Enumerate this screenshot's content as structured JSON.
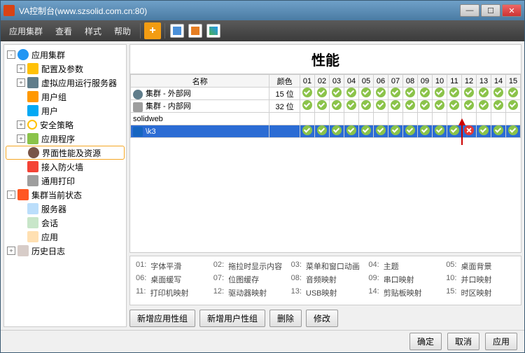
{
  "window": {
    "title": "VA控制台(www.szsolid.com.cn:80)"
  },
  "menu": {
    "appcluster": "应用集群",
    "view": "查看",
    "style": "样式",
    "help": "帮助"
  },
  "tree": {
    "root": "应用集群",
    "items": [
      {
        "label": "配置及参数",
        "icon": "ic-cfg",
        "exp": "+"
      },
      {
        "label": "虚拟应用运行服务器",
        "icon": "ic-srv",
        "exp": "+"
      },
      {
        "label": "用户组",
        "icon": "ic-grp",
        "exp": ""
      },
      {
        "label": "用户",
        "icon": "ic-usr",
        "exp": ""
      },
      {
        "label": "安全策略",
        "icon": "ic-sec",
        "exp": "+"
      },
      {
        "label": "应用程序",
        "icon": "ic-prog",
        "exp": "+"
      },
      {
        "label": "界面性能及资源",
        "icon": "ic-perf",
        "exp": "",
        "selected": true
      },
      {
        "label": "接入防火墙",
        "icon": "ic-fw",
        "exp": ""
      },
      {
        "label": "通用打印",
        "icon": "ic-prn",
        "exp": ""
      }
    ],
    "status": {
      "label": "集群当前状态",
      "children": [
        {
          "label": "服务器",
          "icon": "ic-server"
        },
        {
          "label": "会话",
          "icon": "ic-sess"
        },
        {
          "label": "应用",
          "icon": "ic-app2"
        }
      ]
    },
    "history": "历史日志"
  },
  "panel": {
    "title": "性能",
    "headers": {
      "name": "名称",
      "color": "颜色"
    },
    "cols": [
      "01",
      "02",
      "03",
      "04",
      "05",
      "06",
      "07",
      "08",
      "09",
      "10",
      "11",
      "12",
      "13",
      "14",
      "15"
    ],
    "rows": [
      {
        "name": "集群 - 外部网",
        "icon": "ri-globe",
        "color": "15 位",
        "fail": []
      },
      {
        "name": "集群 - 内部网",
        "icon": "ri-home",
        "color": "32 位",
        "fail": []
      },
      {
        "name": "solidweb",
        "icon": "",
        "color": "",
        "fail": [],
        "empty": true
      },
      {
        "name": "\\k3",
        "icon": "ri-k",
        "color": "",
        "fail": [
          12
        ],
        "selected": true
      }
    ]
  },
  "legend": [
    [
      {
        "n": "01:",
        "t": "字体平滑"
      },
      {
        "n": "02:",
        "t": "拖拉时显示内容"
      },
      {
        "n": "03:",
        "t": "菜单和窗口动画"
      },
      {
        "n": "04:",
        "t": "主题"
      },
      {
        "n": "05:",
        "t": "桌面背景"
      }
    ],
    [
      {
        "n": "06:",
        "t": "桌面缓写"
      },
      {
        "n": "07:",
        "t": "位图缓存"
      },
      {
        "n": "08:",
        "t": "音频映射"
      },
      {
        "n": "09:",
        "t": "串口映射"
      },
      {
        "n": "10:",
        "t": "并口映射"
      }
    ],
    [
      {
        "n": "11:",
        "t": "打印机映射"
      },
      {
        "n": "12:",
        "t": "驱动器映射"
      },
      {
        "n": "13:",
        "t": "USB映射"
      },
      {
        "n": "14:",
        "t": "剪贴板映射"
      },
      {
        "n": "15:",
        "t": "时区映射"
      }
    ]
  ],
  "actions": {
    "addAppGrp": "新增应用性组",
    "addUsrGrp": "新增用户性组",
    "delete": "删除",
    "modify": "修改"
  },
  "footer": {
    "ok": "确定",
    "cancel": "取消",
    "apply": "应用"
  }
}
